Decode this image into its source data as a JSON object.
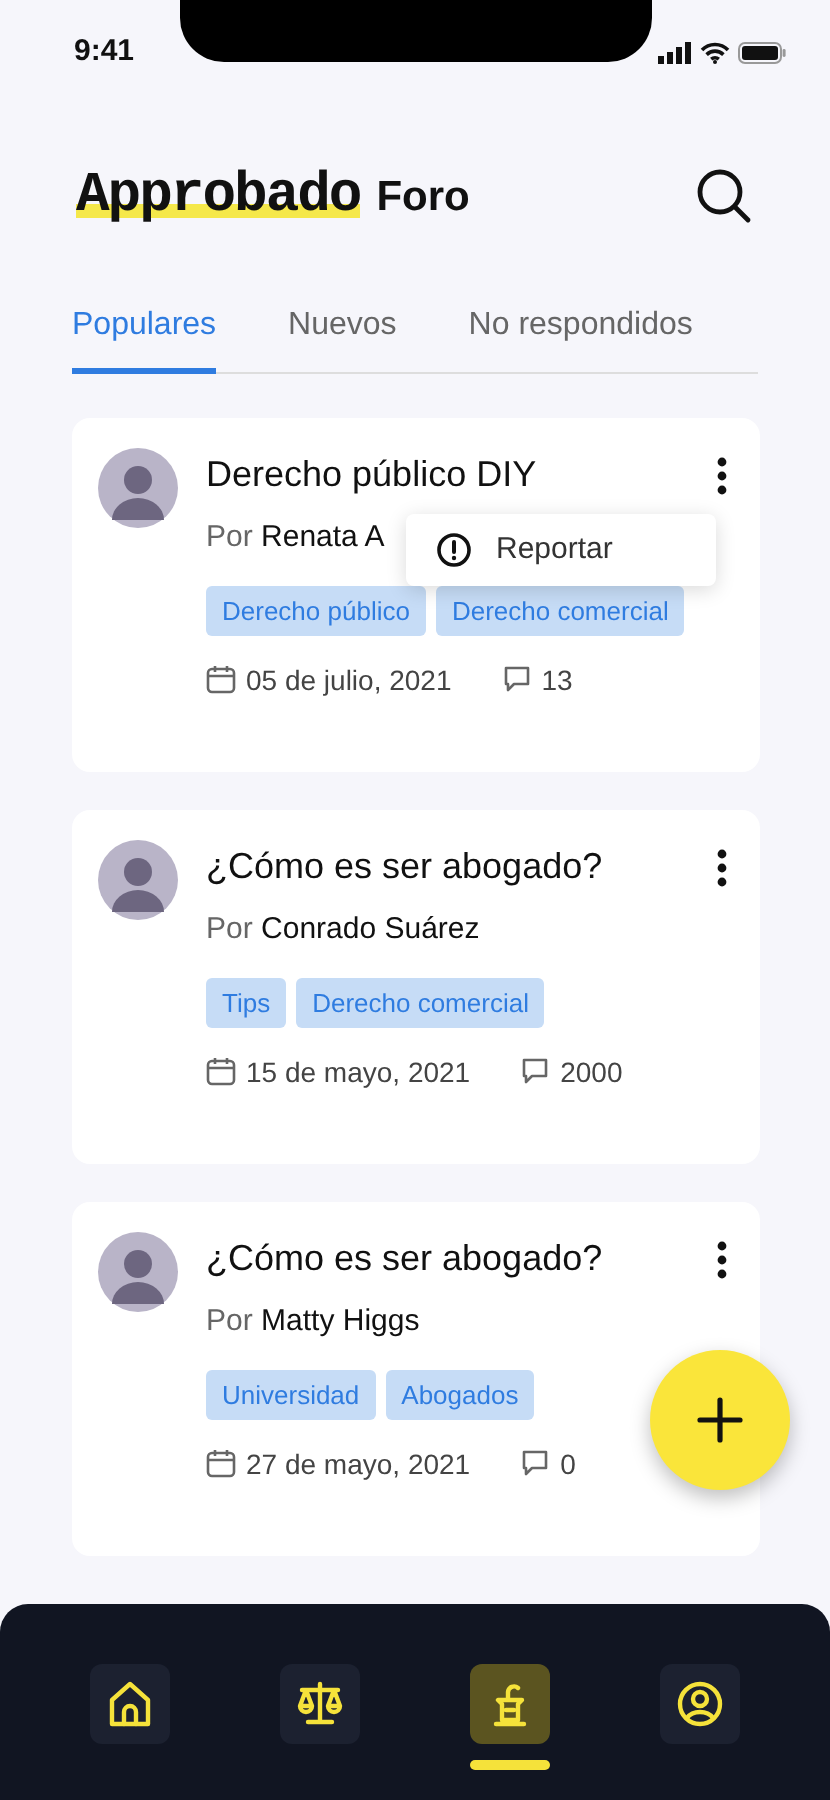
{
  "status_bar": {
    "time": "9:41"
  },
  "header": {
    "logo": "Approbado",
    "title": "Foro"
  },
  "tabs": [
    {
      "label": "Populares",
      "selected": true
    },
    {
      "label": "Nuevos",
      "selected": false
    },
    {
      "label": "No respondidos",
      "selected": false
    }
  ],
  "posts": [
    {
      "title": "Derecho público DIY",
      "by": "Por",
      "author": "Renata A",
      "tags": [
        "Derecho público",
        "Derecho comercial"
      ],
      "date": "05 de julio, 2021",
      "comments": "13",
      "menu": {
        "label": "Reportar"
      }
    },
    {
      "title": "¿Cómo es ser abogado?",
      "by": "Por",
      "author": "Conrado Suárez",
      "tags": [
        "Tips",
        "Derecho comercial"
      ],
      "date": "15 de mayo, 2021",
      "comments": "2000"
    },
    {
      "title": "¿Cómo es ser abogado?",
      "by": "Por",
      "author": "Matty Higgs",
      "tags": [
        "Universidad",
        "Abogados"
      ],
      "date": "27  de mayo, 2021",
      "comments": "0"
    }
  ],
  "nav": [
    {
      "kind": "home",
      "selected": false
    },
    {
      "kind": "scales",
      "selected": false
    },
    {
      "kind": "podium",
      "selected": true
    },
    {
      "kind": "profile",
      "selected": false
    }
  ]
}
